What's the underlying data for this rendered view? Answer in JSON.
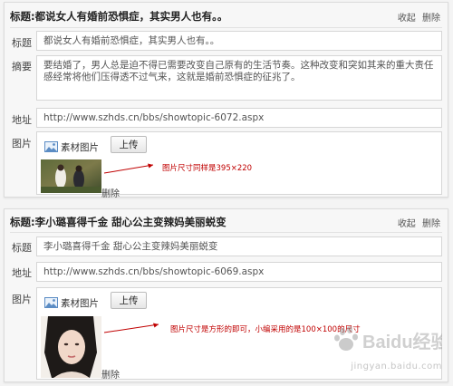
{
  "panels": [
    {
      "title": "标题:都说女人有婚前恐惧症，其实男人也有。。",
      "collapse_label": "收起",
      "delete_label": "删除",
      "title_label": "标题",
      "title_value": "都说女人有婚前恐惧症，其实男人也有。。",
      "summary_label": "摘要",
      "summary_value": "要结婚了，男人总是迫不得已需要改变自己原有的生活节奏。这种改变和突如其来的重大责任感经常将他们压得透不过气来，这就是婚前恐惧症的征兆了。",
      "address_label": "地址",
      "address_value": "http://www.szhds.cn/bbs/showtopic-6072.aspx",
      "image_label": "图片",
      "asset_label": "素材图片",
      "upload_label": "上传",
      "remove_label": "删除",
      "annotation": "图片尺寸同样是395×220"
    },
    {
      "title": "标题:李小璐喜得千金 甜心公主变辣妈美丽蜕变",
      "collapse_label": "收起",
      "delete_label": "删除",
      "title_label": "标题",
      "title_value": "李小璐喜得千金 甜心公主变辣妈美丽蜕变",
      "address_label": "地址",
      "address_value": "http://www.szhds.cn/bbs/showtopic-6069.aspx",
      "image_label": "图片",
      "asset_label": "素材图片",
      "upload_label": "上传",
      "remove_label": "删除",
      "annotation": "图片尺寸是方形的即可，小编采用的是100×100的尺寸"
    }
  ],
  "watermark": {
    "brand": "Baidu经验",
    "url": "jingyan.baidu.com"
  },
  "colors": {
    "panel_bg": "#f7f7f7",
    "field_border": "#d6d6d6",
    "annotation_red": "#c00000"
  },
  "icons": [
    "image-icon",
    "arrow-icon",
    "baidu-paw-icon"
  ]
}
